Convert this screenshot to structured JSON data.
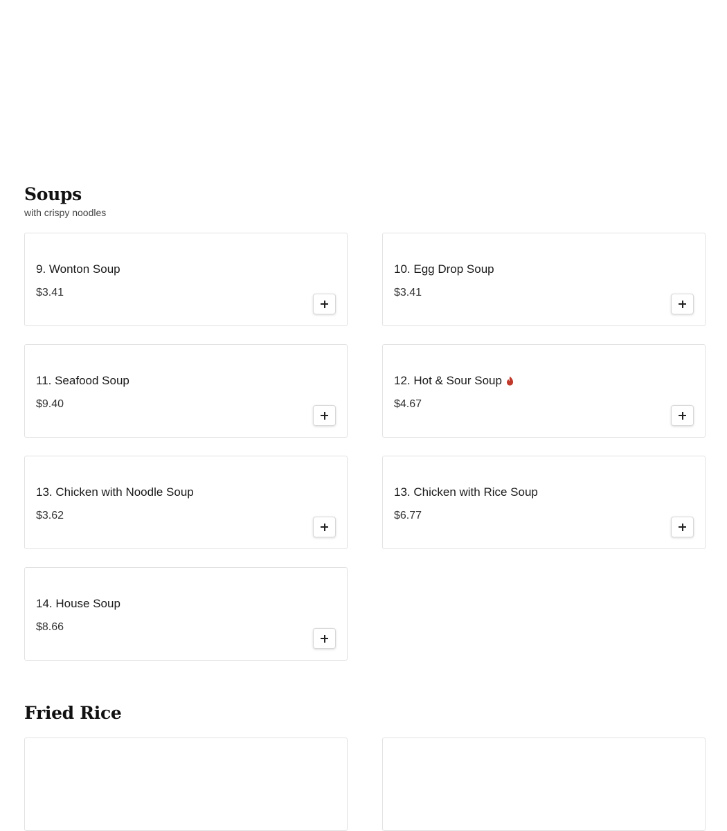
{
  "sections": [
    {
      "title": "Soups",
      "subtitle": "with crispy noodles",
      "items": [
        {
          "name": "9. Wonton Soup",
          "price": "$3.41",
          "spicy": false
        },
        {
          "name": "10. Egg Drop Soup",
          "price": "$3.41",
          "spicy": false
        },
        {
          "name": "11. Seafood Soup",
          "price": "$9.40",
          "spicy": false
        },
        {
          "name": "12. Hot & Sour Soup",
          "price": "$4.67",
          "spicy": true
        },
        {
          "name": "13. Chicken with Noodle Soup",
          "price": "$3.62",
          "spicy": false
        },
        {
          "name": "13. Chicken with Rice Soup",
          "price": "$6.77",
          "spicy": false
        },
        {
          "name": "14. House Soup",
          "price": "$8.66",
          "spicy": false
        }
      ]
    },
    {
      "title": "Fried Rice",
      "subtitle": ""
    }
  ],
  "icons": {
    "add": "plus-icon",
    "spicy": "chili-pepper-icon"
  },
  "colors": {
    "spicy": "#c0392b",
    "card_border": "#e2e2e2"
  }
}
